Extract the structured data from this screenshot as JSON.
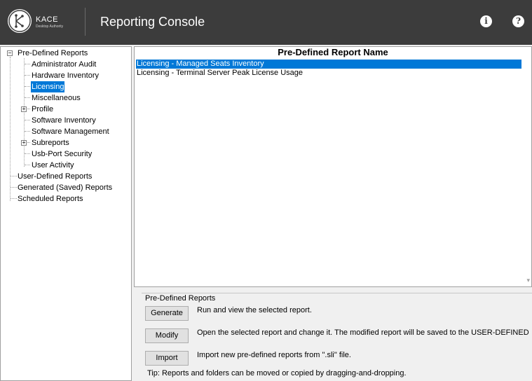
{
  "header": {
    "brand": "KACE",
    "brand_sub": "Desktop Authority",
    "title": "Reporting Console",
    "info_glyph": "i",
    "help_glyph": "?"
  },
  "tree": {
    "root": "Pre-Defined Reports",
    "children": [
      "Administrator Audit",
      "Hardware Inventory",
      "Licensing",
      "Miscellaneous",
      "Profile",
      "Software Inventory",
      "Software Management",
      "Subreports",
      "Usb-Port Security",
      "User Activity"
    ],
    "selected": "Licensing",
    "others": [
      "User-Defined Reports",
      "Generated (Saved) Reports",
      "Scheduled Reports"
    ]
  },
  "report_list": {
    "header": "Pre-Defined Report Name",
    "rows": [
      "Licensing - Managed Seats Inventory",
      "Licensing - Terminal Server Peak License Usage"
    ],
    "selected_row": "Licensing - Managed Seats Inventory"
  },
  "actions": {
    "group_title": "Pre-Defined Reports",
    "generate_label": "Generate",
    "generate_desc": "Run and view the selected report.",
    "modify_label": "Modify",
    "modify_desc": "Open the selected report and change it.  The modified report will be saved to the USER-DEFINED",
    "import_label": "Import",
    "import_desc": "Import new pre-defined reports from \".sli\" file.",
    "tip": "Tip:  Reports and folders can be moved or copied by dragging-and-dropping."
  },
  "colors": {
    "header_bg": "#3c3c3c",
    "selection": "#0078d7"
  }
}
